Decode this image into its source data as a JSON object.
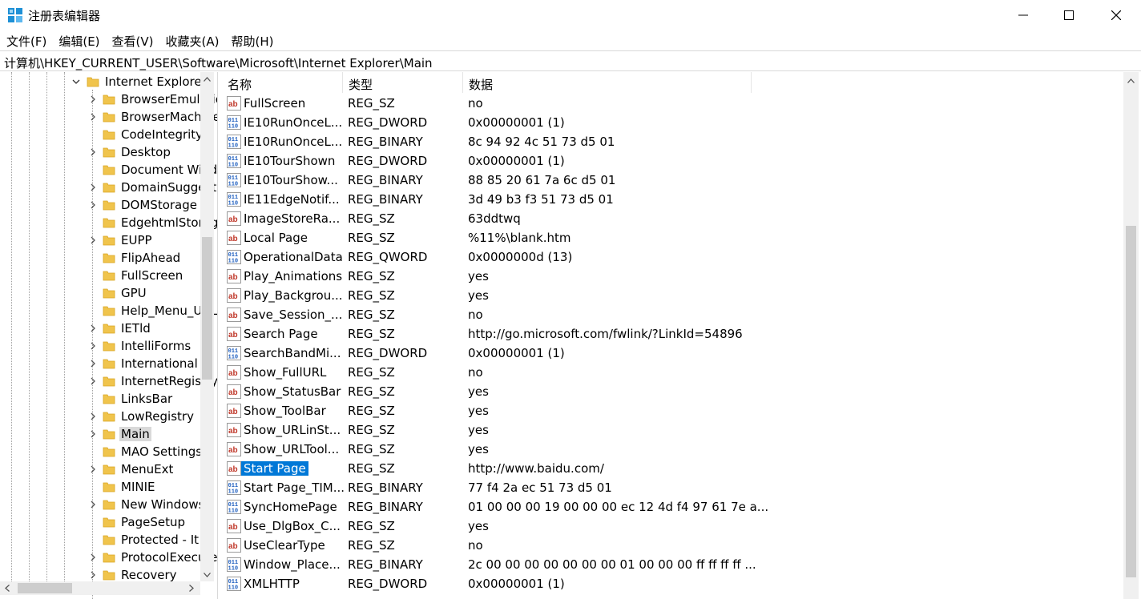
{
  "window": {
    "title": "注册表编辑器",
    "minimize_icon": "minimize-icon",
    "maximize_icon": "maximize-icon",
    "close_icon": "close-icon"
  },
  "menu": [
    "文件(F)",
    "编辑(E)",
    "查看(V)",
    "收藏夹(A)",
    "帮助(H)"
  ],
  "address": "计算机\\HKEY_CURRENT_USER\\Software\\Microsoft\\Internet Explorer\\Main",
  "tree": {
    "parent": "Internet Explorer",
    "children": [
      {
        "label": "BrowserEmulation",
        "expandable": true
      },
      {
        "label": "BrowserMachine",
        "expandable": true
      },
      {
        "label": "CodeIntegrity",
        "expandable": false
      },
      {
        "label": "Desktop",
        "expandable": true
      },
      {
        "label": "Document Windows",
        "expandable": false
      },
      {
        "label": "DomainSuggestion",
        "expandable": true
      },
      {
        "label": "DOMStorage",
        "expandable": true
      },
      {
        "label": "EdgehtmlStorage",
        "expandable": false
      },
      {
        "label": "EUPP",
        "expandable": true
      },
      {
        "label": "FlipAhead",
        "expandable": false
      },
      {
        "label": "FullScreen",
        "expandable": false
      },
      {
        "label": "GPU",
        "expandable": false
      },
      {
        "label": "Help_Menu_URLs",
        "expandable": false
      },
      {
        "label": "IETld",
        "expandable": true
      },
      {
        "label": "IntelliForms",
        "expandable": true
      },
      {
        "label": "International",
        "expandable": true
      },
      {
        "label": "InternetRegistry",
        "expandable": true
      },
      {
        "label": "LinksBar",
        "expandable": false
      },
      {
        "label": "LowRegistry",
        "expandable": true
      },
      {
        "label": "Main",
        "expandable": true,
        "selected": true
      },
      {
        "label": "MAO Settings",
        "expandable": false
      },
      {
        "label": "MenuExt",
        "expandable": true
      },
      {
        "label": "MINIE",
        "expandable": false
      },
      {
        "label": "New Windows",
        "expandable": true
      },
      {
        "label": "PageSetup",
        "expandable": false
      },
      {
        "label": "Protected - It",
        "expandable": false
      },
      {
        "label": "ProtocolExecute",
        "expandable": true
      },
      {
        "label": "Recovery",
        "expandable": true
      }
    ]
  },
  "list": {
    "headers": {
      "name": "名称",
      "type": "类型",
      "data": "数据"
    },
    "rows": [
      {
        "name": "FullScreen",
        "type": "REG_SZ",
        "data": "no",
        "icon": "string-value-icon"
      },
      {
        "name": "IE10RunOnceL...",
        "type": "REG_DWORD",
        "data": "0x00000001 (1)",
        "icon": "binary-value-icon"
      },
      {
        "name": "IE10RunOnceL...",
        "type": "REG_BINARY",
        "data": "8c 94 92 4c 51 73 d5 01",
        "icon": "binary-value-icon"
      },
      {
        "name": "IE10TourShown",
        "type": "REG_DWORD",
        "data": "0x00000001 (1)",
        "icon": "binary-value-icon"
      },
      {
        "name": "IE10TourShow...",
        "type": "REG_BINARY",
        "data": "88 85 20 61 7a 6c d5 01",
        "icon": "binary-value-icon"
      },
      {
        "name": "IE11EdgeNotif...",
        "type": "REG_BINARY",
        "data": "3d 49 b3 f3 51 73 d5 01",
        "icon": "binary-value-icon"
      },
      {
        "name": "ImageStoreRa...",
        "type": "REG_SZ",
        "data": "63ddtwq",
        "icon": "string-value-icon"
      },
      {
        "name": "Local Page",
        "type": "REG_SZ",
        "data": "%11%\\blank.htm",
        "icon": "string-value-icon"
      },
      {
        "name": "OperationalData",
        "type": "REG_QWORD",
        "data": "0x0000000d (13)",
        "icon": "binary-value-icon"
      },
      {
        "name": "Play_Animations",
        "type": "REG_SZ",
        "data": "yes",
        "icon": "string-value-icon"
      },
      {
        "name": "Play_Backgrou...",
        "type": "REG_SZ",
        "data": "yes",
        "icon": "string-value-icon"
      },
      {
        "name": "Save_Session_...",
        "type": "REG_SZ",
        "data": "no",
        "icon": "string-value-icon"
      },
      {
        "name": "Search Page",
        "type": "REG_SZ",
        "data": "http://go.microsoft.com/fwlink/?LinkId=54896",
        "icon": "string-value-icon"
      },
      {
        "name": "SearchBandMi...",
        "type": "REG_DWORD",
        "data": "0x00000001 (1)",
        "icon": "binary-value-icon"
      },
      {
        "name": "Show_FullURL",
        "type": "REG_SZ",
        "data": "no",
        "icon": "string-value-icon"
      },
      {
        "name": "Show_StatusBar",
        "type": "REG_SZ",
        "data": "yes",
        "icon": "string-value-icon"
      },
      {
        "name": "Show_ToolBar",
        "type": "REG_SZ",
        "data": "yes",
        "icon": "string-value-icon"
      },
      {
        "name": "Show_URLinSt...",
        "type": "REG_SZ",
        "data": "yes",
        "icon": "string-value-icon"
      },
      {
        "name": "Show_URLTool...",
        "type": "REG_SZ",
        "data": "yes",
        "icon": "string-value-icon"
      },
      {
        "name": "Start Page",
        "type": "REG_SZ",
        "data": "http://www.baidu.com/",
        "icon": "string-value-icon",
        "selected": true
      },
      {
        "name": "Start Page_TIM...",
        "type": "REG_BINARY",
        "data": "77 f4 2a ec 51 73 d5 01",
        "icon": "binary-value-icon"
      },
      {
        "name": "SyncHomePage",
        "type": "REG_BINARY",
        "data": "01 00 00 00 19 00 00 00 ec 12 4d f4 97 61 7e a...",
        "icon": "binary-value-icon"
      },
      {
        "name": "Use_DlgBox_C...",
        "type": "REG_SZ",
        "data": "yes",
        "icon": "string-value-icon"
      },
      {
        "name": "UseClearType",
        "type": "REG_SZ",
        "data": "no",
        "icon": "string-value-icon"
      },
      {
        "name": "Window_Place...",
        "type": "REG_BINARY",
        "data": "2c 00 00 00 00 00 00 00 01 00 00 00 ff ff ff ff ...",
        "icon": "binary-value-icon"
      },
      {
        "name": "XMLHTTP",
        "type": "REG_DWORD",
        "data": "0x00000001 (1)",
        "icon": "binary-value-icon"
      }
    ]
  },
  "colors": {
    "selection": "#0078d7",
    "folder": "#f0c44c",
    "tree_selected": "#d9d9d9"
  }
}
